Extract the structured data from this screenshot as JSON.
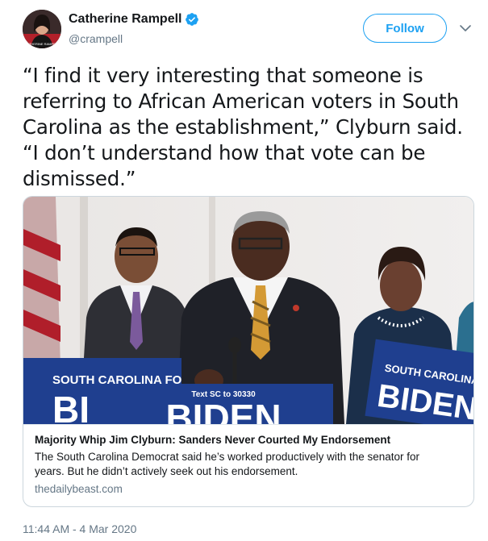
{
  "author": {
    "display_name": "Catherine Rampell",
    "handle": "@crampell",
    "avatar_icon": "avatar-photo",
    "verified_icon": "verified-badge-icon",
    "avatar_caption": "CATHERINE RAMPELL"
  },
  "actions": {
    "follow_label": "Follow",
    "more_icon": "chevron-down-icon"
  },
  "tweet": {
    "line1": "“I find it very interesting that someone is",
    "line2": "referring to African American voters in South",
    "line3": "Carolina as the establishment,” Clyburn said.",
    "line4": "“I don’t understand how that vote can be",
    "line5": "dismissed.”"
  },
  "card": {
    "title": "Majority Whip Jim Clyburn: Sanders Never Courted My Endorsement",
    "description_line1": "The South Carolina Democrat said he’s worked productively with the senator for",
    "description_line2": "years. But he didn’t actively seek out his endorsement.",
    "domain": "thedailybeast.com",
    "image": {
      "sign_left_top": "SOUTH CAROLINA FO",
      "sign_left_big": "BI",
      "sign_center_top": "Text SC to 30330",
      "sign_center_big": "BIDEN",
      "sign_right_top": "SOUTH CAROLINA FO",
      "sign_right_big": "BIDEN"
    }
  },
  "timestamp": "11:44 AM - 4 Mar 2020",
  "colors": {
    "accent": "#1da1f2",
    "text": "#14171a",
    "muted": "#657786",
    "sign_blue": "#1f3f8f"
  }
}
